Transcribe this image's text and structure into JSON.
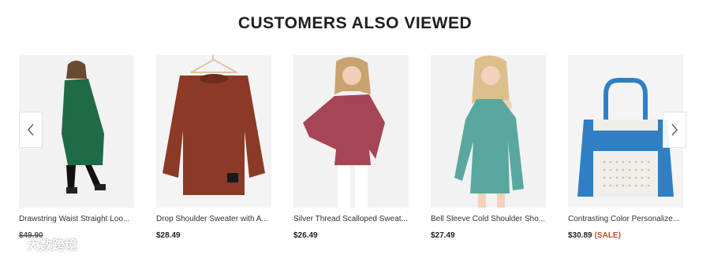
{
  "section": {
    "heading": "CUSTOMERS ALSO VIEWED"
  },
  "products": [
    {
      "title": "Drawstring Waist Straight Loo...",
      "price": "$49.90",
      "sale_label": "",
      "image": "green-cardigan-model",
      "color": "#1f6b48"
    },
    {
      "title": "Drop Shoulder Sweater with A...",
      "price": "$28.49",
      "sale_label": "",
      "image": "rust-sweater-hanger",
      "color": "#8b3a26"
    },
    {
      "title": "Silver Thread Scalloped Sweat...",
      "price": "$26.49",
      "sale_label": "",
      "image": "rose-sweater-model",
      "color": "#a64556"
    },
    {
      "title": "Bell Sleeve Cold Shoulder Sho...",
      "price": "$27.49",
      "sale_label": "",
      "image": "teal-dress-model",
      "color": "#59a89f"
    },
    {
      "title": "Contrasting Color Personalize...",
      "price": "$30.89",
      "sale_label": "(SALE)",
      "image": "blue-white-handbag",
      "color": "#2f7fc4"
    }
  ],
  "carousel": {
    "prev_icon": "chevron-left-icon",
    "next_icon": "chevron-right-icon"
  },
  "watermark": {
    "text": "大数跨境",
    "icon": "brand-logo-icon"
  }
}
